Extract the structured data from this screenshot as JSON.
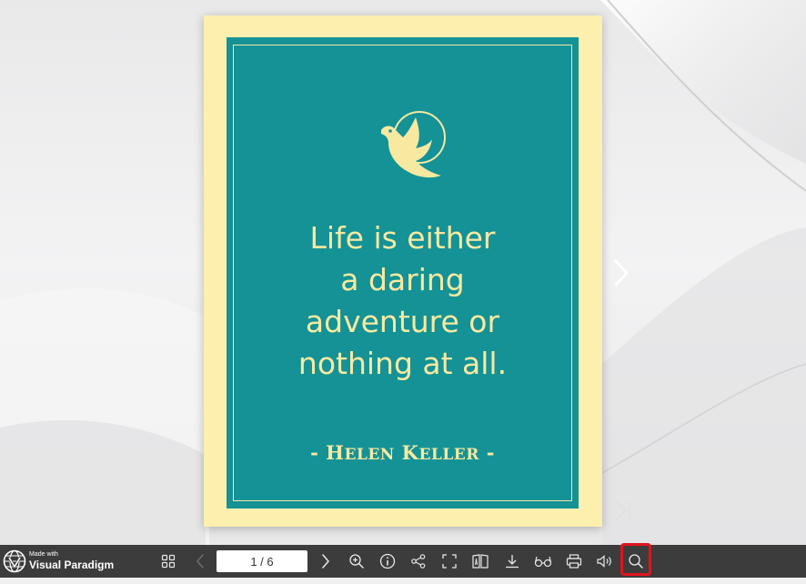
{
  "flipbook": {
    "quote_lines": [
      "Life is either",
      "a daring",
      "adventure or",
      "nothing at all."
    ],
    "author_dash_left": "- ",
    "author_first_initial": "H",
    "author_first_rest": "ELEN",
    "author_last_initial": "K",
    "author_last_rest": "ELLER",
    "author_dash_right": " -"
  },
  "colors": {
    "cream": "#fdefad",
    "teal": "#149296",
    "text": "#f8e9a1",
    "toolbar": "#3c3c3c",
    "highlight": "#e0141e"
  },
  "toolbar": {
    "logo_made_with": "Made with",
    "logo_name": "Visual Paradigm",
    "page_indicator": "1 / 6",
    "icons": [
      "thumbnails-icon",
      "prev-page-icon",
      "next-page-icon",
      "zoom-in-icon",
      "info-icon",
      "share-icon",
      "fullscreen-icon",
      "single-page-icon",
      "download-icon",
      "reader-glasses-icon",
      "print-icon",
      "sound-icon",
      "search-icon"
    ]
  }
}
